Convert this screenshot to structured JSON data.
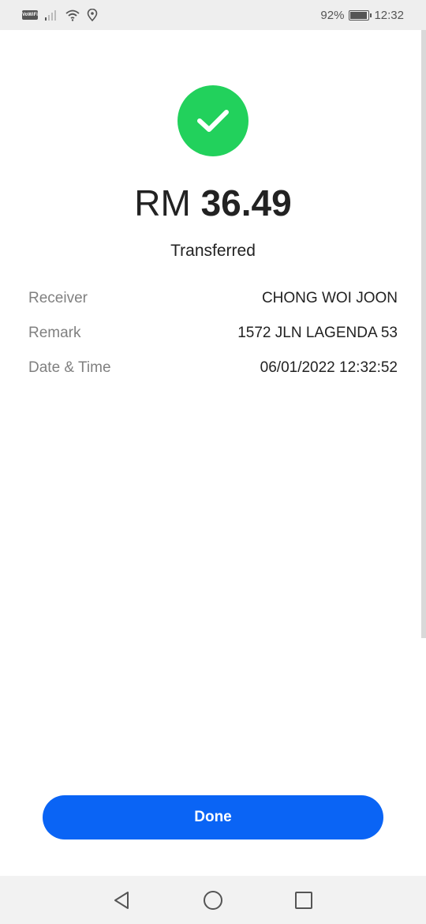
{
  "status_bar": {
    "wifi_badge": "VoWiFi",
    "battery_percent": "92%",
    "battery_level": 0.92,
    "time": "12:32"
  },
  "receipt": {
    "currency": "RM",
    "amount": "36.49",
    "status": "Transferred",
    "details": [
      {
        "label": "Receiver",
        "value": "CHONG WOI JOON"
      },
      {
        "label": "Remark",
        "value": "1572 JLN LAGENDA 53"
      },
      {
        "label": "Date & Time",
        "value": "06/01/2022 12:32:52"
      }
    ]
  },
  "actions": {
    "done_label": "Done"
  },
  "colors": {
    "success": "#22d15c",
    "primary": "#0a64f5"
  },
  "icons": {
    "success": "check-icon",
    "nav_back": "back-triangle-icon",
    "nav_home": "home-circle-icon",
    "nav_recents": "recents-square-icon"
  }
}
